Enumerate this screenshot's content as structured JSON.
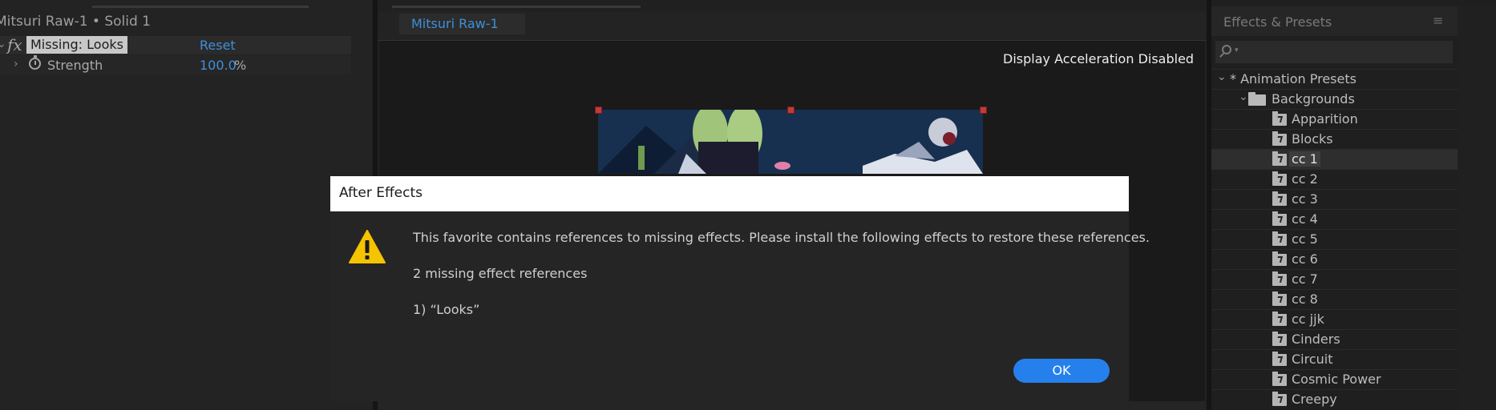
{
  "effect_controls": {
    "title": "Mitsuri Raw-1 • Solid 1",
    "fx_symbol": "fx",
    "effect_name": "Missing: Looks",
    "reset_label": "Reset",
    "property_label": "Strength",
    "property_value": "100.0",
    "property_unit": "%"
  },
  "composition": {
    "tab_label": "Mitsuri Raw-1",
    "status_text": "Display Acceleration Disabled"
  },
  "effects_presets": {
    "title": "Effects & Presets",
    "menu_icon": "≡",
    "root_label": "* Animation Presets",
    "folder_label": "Backgrounds",
    "selected_item": "cc 1",
    "items": [
      "Apparition",
      "Blocks",
      "cc 1",
      "cc 2",
      "cc 3",
      "cc 4",
      "cc 5",
      "cc 6",
      "cc 7",
      "cc 8",
      "cc jjk",
      "Cinders",
      "Circuit",
      "Cosmic Power",
      "Creepy"
    ]
  },
  "dialog": {
    "title": "After Effects",
    "message": "This favorite contains references to missing effects. Please install the following effects to restore these references.",
    "count_text": "2 missing effect references",
    "item_text": "1)  “Looks”",
    "ok_label": "OK"
  },
  "colors": {
    "accent_blue": "#3f8fd9",
    "ok_button": "#2680eb",
    "warning_yellow": "#f5c400",
    "handle_red": "#c23a3a"
  }
}
